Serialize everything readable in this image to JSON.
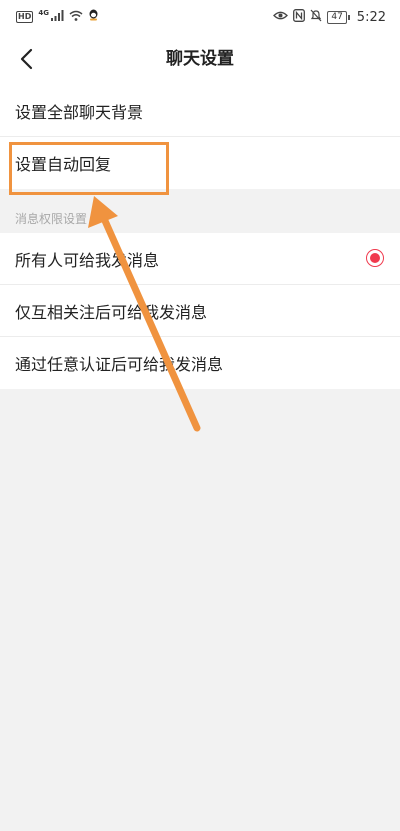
{
  "status_bar": {
    "hd": "HD",
    "network": "4G",
    "battery": "47",
    "time": "5:22"
  },
  "header": {
    "title": "聊天设置"
  },
  "settings": {
    "chat_background": "设置全部聊天背景",
    "auto_reply": "设置自动回复"
  },
  "permissions": {
    "section_title": "消息权限设置",
    "options": [
      {
        "label": "所有人可给我发消息",
        "selected": true
      },
      {
        "label": "仅互相关注后可给我发消息",
        "selected": false
      },
      {
        "label": "通过任意认证后可给我发消息",
        "selected": false
      }
    ]
  },
  "colors": {
    "accent": "#f03a4e",
    "annotation": "#f0933f",
    "background": "#f2f2f2"
  }
}
